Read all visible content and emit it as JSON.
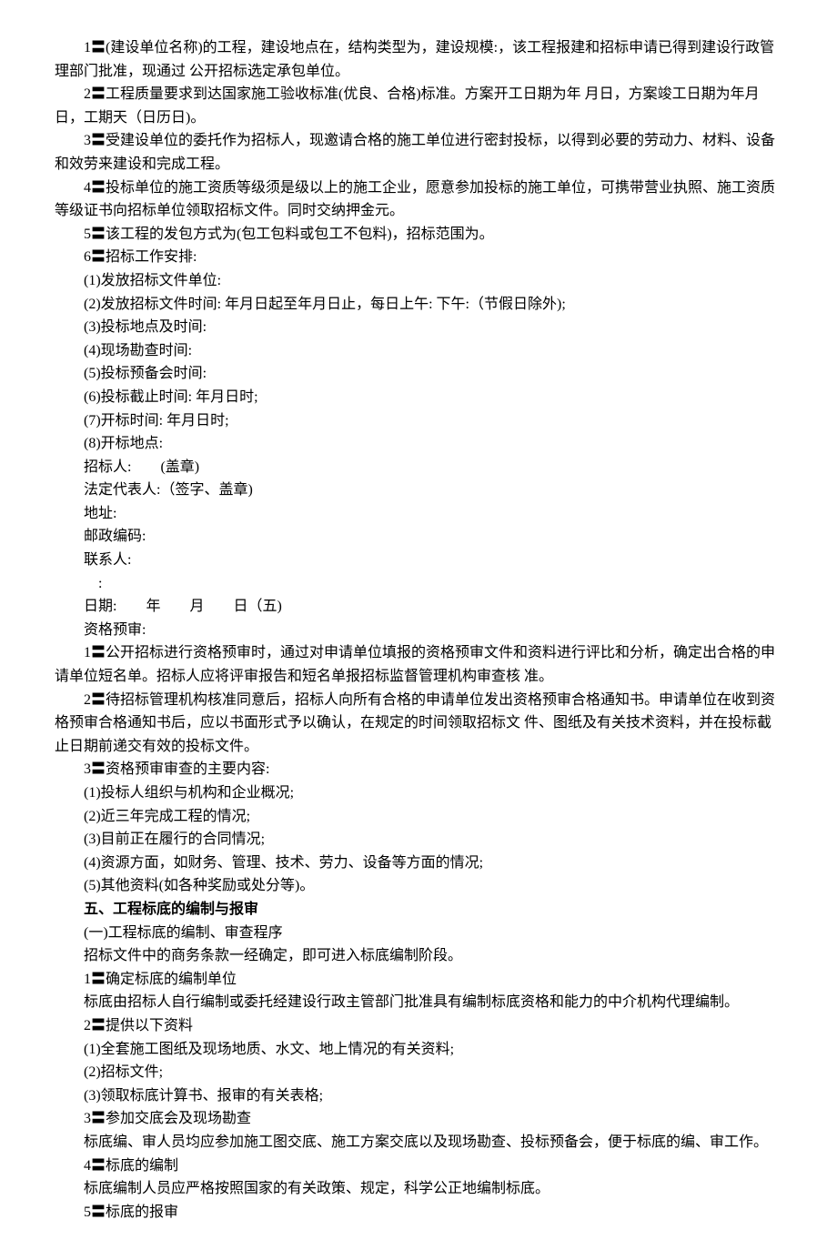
{
  "lines": [
    {
      "cls": "para",
      "text": "1〓(建设单位名称)的工程，建设地点在，结构类型为，建设规模:，该工程报建和招标申请已得到建设行政管理部门批准，现通过 公开招标选定承包单位。"
    },
    {
      "cls": "para",
      "text": "2〓工程质量要求到达国家施工验收标准(优良、合格)标准。方案开工日期为年 月日，方案竣工日期为年月日，工期天（日历日)。"
    },
    {
      "cls": "para",
      "text": "3〓受建设单位的委托作为招标人，现邀请合格的施工单位进行密封投标，以得到必要的劳动力、材料、设备和效劳来建设和完成工程。"
    },
    {
      "cls": "para",
      "text": "4〓投标单位的施工资质等级须是级以上的施工企业，愿意参加投标的施工单位，可携带营业执照、施工资质等级证书向招标单位领取招标文件。同时交纳押金元。"
    },
    {
      "cls": "para",
      "text": "5〓该工程的发包方式为(包工包料或包工不包料)，招标范围为。"
    },
    {
      "cls": "para",
      "text": "6〓招标工作安排:"
    },
    {
      "cls": "para",
      "text": "(1)发放招标文件单位:"
    },
    {
      "cls": "para",
      "text": "(2)发放招标文件时间: 年月日起至年月日止，每日上午: 下午:（节假日除外);"
    },
    {
      "cls": "para",
      "text": "(3)投标地点及时间:"
    },
    {
      "cls": "para",
      "text": "(4)现场勘查时间:"
    },
    {
      "cls": "para",
      "text": "(5)投标预备会时间:"
    },
    {
      "cls": "para",
      "text": "(6)投标截止时间: 年月日时;"
    },
    {
      "cls": "para",
      "text": "(7)开标时间: 年月日时;"
    },
    {
      "cls": "para",
      "text": "(8)开标地点:"
    },
    {
      "cls": "para",
      "text": "招标人:　　(盖章)"
    },
    {
      "cls": "para",
      "text": "法定代表人:（签字、盖章)"
    },
    {
      "cls": "para",
      "text": "地址:"
    },
    {
      "cls": "para",
      "text": "邮政编码:"
    },
    {
      "cls": "para",
      "text": "联系人:"
    },
    {
      "cls": "para",
      "text": "　:"
    },
    {
      "cls": "para",
      "text": "日期:　　年　　月　　日（五)"
    },
    {
      "cls": "para",
      "text": "资格预审:"
    },
    {
      "cls": "para",
      "text": "1〓公开招标进行资格预审时，通过对申请单位填报的资格预审文件和资料进行评比和分析，确定出合格的申请单位短名单。招标人应将评审报告和短名单报招标监督管理机构审查核 准。"
    },
    {
      "cls": "para",
      "text": "2〓待招标管理机构核准同意后，招标人向所有合格的申请单位发出资格预审合格通知书。申请单位在收到资格预审合格通知书后，应以书面形式予以确认，在规定的时间领取招标文 件、图纸及有关技术资料，并在投标截止日期前递交有效的投标文件。"
    },
    {
      "cls": "para",
      "text": "3〓资格预审审查的主要内容:"
    },
    {
      "cls": "para",
      "text": "(1)投标人组织与机构和企业概况;"
    },
    {
      "cls": "para",
      "text": "(2)近三年完成工程的情况;"
    },
    {
      "cls": "para",
      "text": "(3)目前正在履行的合同情况;"
    },
    {
      "cls": "para",
      "text": "(4)资源方面，如财务、管理、技术、劳力、设备等方面的情况;"
    },
    {
      "cls": "para",
      "text": "(5)其他资料(如各种奖励或处分等)。"
    },
    {
      "cls": "heading",
      "text": "五、工程标底的编制与报审"
    },
    {
      "cls": "para",
      "text": "(一)工程标底的编制、审查程序"
    },
    {
      "cls": "para",
      "text": "招标文件中的商务条款一经确定，即可进入标底编制阶段。"
    },
    {
      "cls": "para",
      "text": "1〓确定标底的编制单位"
    },
    {
      "cls": "para",
      "text": "标底由招标人自行编制或委托经建设行政主管部门批准具有编制标底资格和能力的中介机构代理编制。"
    },
    {
      "cls": "para",
      "text": "2〓提供以下资料"
    },
    {
      "cls": "para",
      "text": "(1)全套施工图纸及现场地质、水文、地上情况的有关资料;"
    },
    {
      "cls": "para",
      "text": "(2)招标文件;"
    },
    {
      "cls": "para",
      "text": "(3)领取标底计算书、报审的有关表格;"
    },
    {
      "cls": "para",
      "text": "3〓参加交底会及现场勘查"
    },
    {
      "cls": "para",
      "text": "标底编、审人员均应参加施工图交底、施工方案交底以及现场勘查、投标预备会，便于标底的编、审工作。"
    },
    {
      "cls": "para",
      "text": "4〓标底的编制"
    },
    {
      "cls": "para",
      "text": "标底编制人员应严格按照国家的有关政策、规定，科学公正地编制标底。"
    },
    {
      "cls": "para",
      "text": "5〓标底的报审"
    }
  ]
}
